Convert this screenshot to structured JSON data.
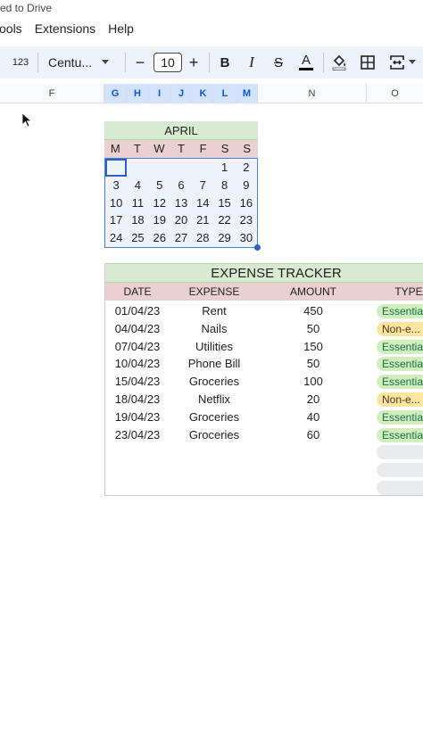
{
  "header": {
    "saved_text": "ed to Drive"
  },
  "menu": [
    "ools",
    "Extensions",
    "Help"
  ],
  "toolbar": {
    "format_number": "123",
    "font_name": "Centu...",
    "font_size": "10",
    "decrease": "−",
    "increase": "+",
    "bold": "B",
    "italic": "I",
    "strike": "S",
    "text_color": "A",
    "text_color_bar": "#000000"
  },
  "columns": {
    "f": "F",
    "g": "G",
    "h": "H",
    "i": "I",
    "j": "J",
    "k": "K",
    "l": "L",
    "m": "M",
    "n": "N",
    "o": "O"
  },
  "calendar": {
    "title": "APRIL",
    "weekdays": [
      "M",
      "T",
      "W",
      "T",
      "F",
      "S",
      "S"
    ],
    "weeks": [
      [
        "",
        "",
        "",
        "",
        "",
        "1",
        "2"
      ],
      [
        "3",
        "4",
        "5",
        "6",
        "7",
        "8",
        "9"
      ],
      [
        "10",
        "11",
        "12",
        "13",
        "14",
        "15",
        "16"
      ],
      [
        "17",
        "18",
        "19",
        "20",
        "21",
        "22",
        "23"
      ],
      [
        "24",
        "25",
        "26",
        "27",
        "28",
        "29",
        "30"
      ]
    ]
  },
  "expenses": {
    "title": "EXPENSE TRACKER",
    "headers": {
      "date": "DATE",
      "expense": "EXPENSE",
      "amount": "AMOUNT",
      "type": "TYPE"
    },
    "rows": [
      {
        "date": "01/04/23",
        "expense": "Rent",
        "amount": "450",
        "type": "Essential"
      },
      {
        "date": "04/04/23",
        "expense": "Nails",
        "amount": "50",
        "type": "Non-e..."
      },
      {
        "date": "07/04/23",
        "expense": "Utilities",
        "amount": "150",
        "type": "Essential"
      },
      {
        "date": "10/04/23",
        "expense": "Phone Bill",
        "amount": "50",
        "type": "Essential"
      },
      {
        "date": "15/04/23",
        "expense": "Groceries",
        "amount": "100",
        "type": "Essential"
      },
      {
        "date": "18/04/23",
        "expense": "Netflix",
        "amount": "20",
        "type": "Non-e..."
      },
      {
        "date": "19/04/23",
        "expense": "Groceries",
        "amount": "40",
        "type": "Essential"
      },
      {
        "date": "23/04/23",
        "expense": "Groceries",
        "amount": "60",
        "type": "Essential"
      }
    ]
  },
  "colors": {
    "calendar_title_bg": "#d9ead3",
    "weekday_bg": "#ead1cf",
    "selection": "#2a62c4",
    "essential_pill": "#d4edbc",
    "non_essential_pill": "#ffe5a0"
  }
}
